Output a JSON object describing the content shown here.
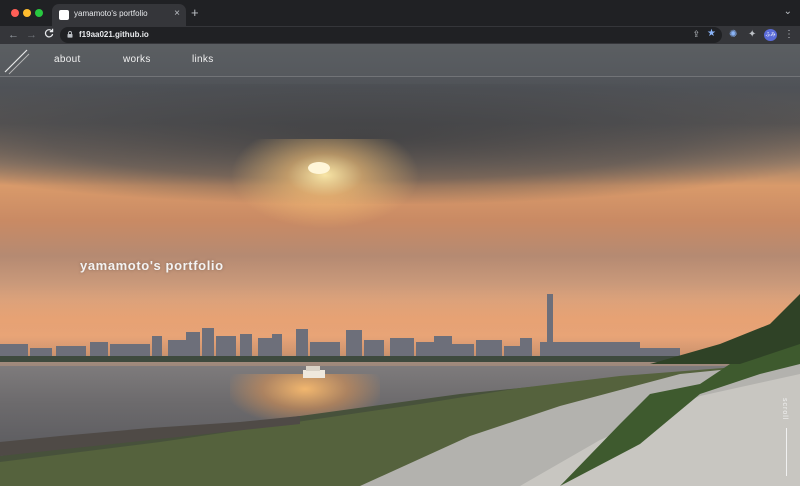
{
  "browser": {
    "tab_title": "yamamoto's portfolio",
    "tab_close_icon": "close-icon",
    "new_tab_glyph": "+",
    "url": "f19aa021.github.io",
    "back_glyph": "←",
    "forward_glyph": "→",
    "reload_glyph": "C",
    "share_glyph": "⇪",
    "star_glyph": "★",
    "ext1_glyph": "✺",
    "ext2_glyph": "✦",
    "avatar_text": "ふみ",
    "menu_glyph": "⋮",
    "tab_menu_glyph": "⌄",
    "accent": "#8ab4f8"
  },
  "site": {
    "nav": [
      {
        "label": "about"
      },
      {
        "label": "works"
      },
      {
        "label": "links"
      }
    ],
    "hero_title": "yamamoto's portfolio",
    "scroll_label": "scroll"
  }
}
